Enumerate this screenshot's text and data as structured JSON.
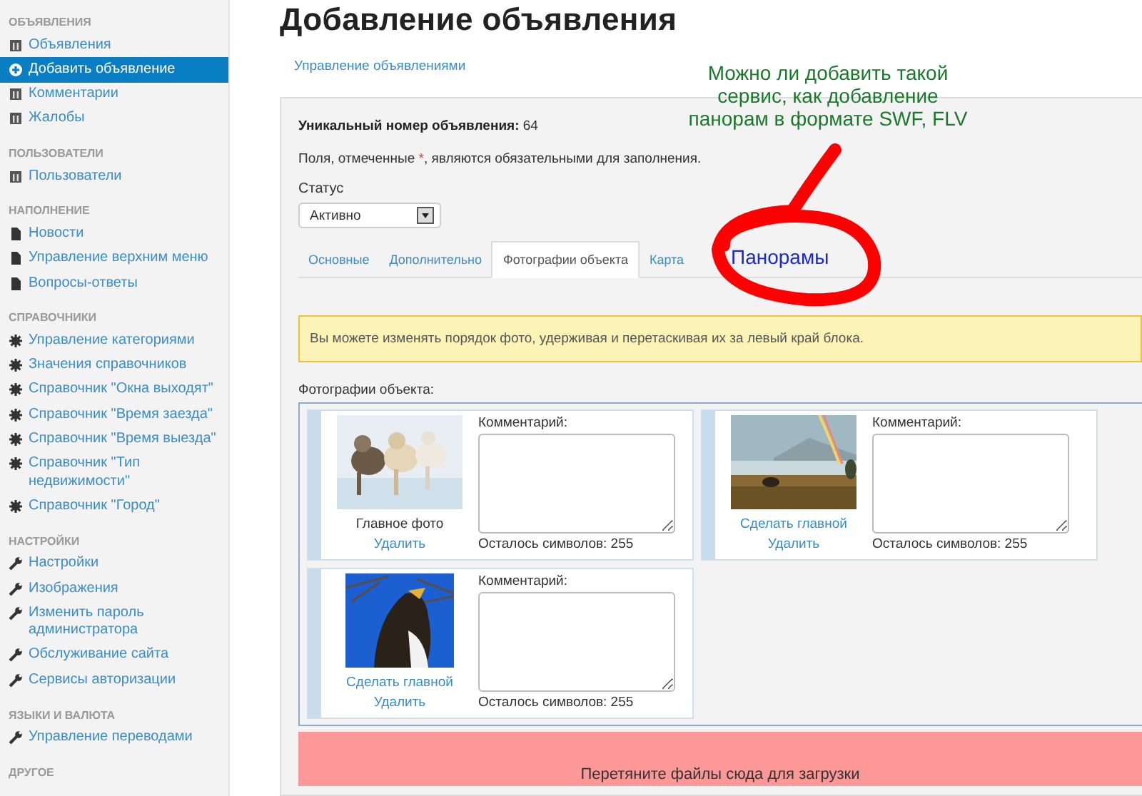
{
  "sidebar": {
    "sections": [
      {
        "title": "ОБЪЯВЛЕНИЯ",
        "items": [
          {
            "label": "Объявления",
            "kind": "table",
            "selected": false
          },
          {
            "label": "Добавить объявление",
            "kind": "plus",
            "selected": true
          },
          {
            "label": "Комментарии",
            "kind": "table",
            "selected": false
          },
          {
            "label": "Жалобы",
            "kind": "table",
            "selected": false
          }
        ]
      },
      {
        "title": "ПОЛЬЗОВАТЕЛИ",
        "items": [
          {
            "label": "Пользователи",
            "kind": "table",
            "selected": false
          }
        ]
      },
      {
        "title": "НАПОЛНЕНИЕ",
        "items": [
          {
            "label": "Новости",
            "kind": "file",
            "selected": false
          },
          {
            "label": "Управление верхним меню",
            "kind": "file",
            "selected": false
          },
          {
            "label": "Вопросы-ответы",
            "kind": "file",
            "selected": false
          }
        ]
      },
      {
        "title": "СПРАВОЧНИКИ",
        "items": [
          {
            "label": "Управление категориями",
            "kind": "gear",
            "selected": false
          },
          {
            "label": "Значения справочников",
            "kind": "gear",
            "selected": false
          },
          {
            "label": "Справочник \"Окна выходят\"",
            "kind": "gear",
            "selected": false
          },
          {
            "label": "Справочник \"Время заезда\"",
            "kind": "gear",
            "selected": false
          },
          {
            "label": "Справочник \"Время выезда\"",
            "kind": "gear",
            "selected": false
          },
          {
            "label": "Справочник \"Тип недвижимости\"",
            "kind": "gear",
            "selected": false
          },
          {
            "label": "Справочник \"Город\"",
            "kind": "gear",
            "selected": false
          }
        ]
      },
      {
        "title": "НАСТРОЙКИ",
        "items": [
          {
            "label": "Настройки",
            "kind": "wrench",
            "selected": false
          },
          {
            "label": "Изображения",
            "kind": "wrench",
            "selected": false
          },
          {
            "label": "Изменить пароль администратора",
            "kind": "wrench",
            "selected": false
          },
          {
            "label": "Обслуживание сайта",
            "kind": "wrench",
            "selected": false
          },
          {
            "label": "Сервисы авторизации",
            "kind": "wrench",
            "selected": false
          }
        ]
      },
      {
        "title": "ЯЗЫКИ И ВАЛЮТА",
        "items": [
          {
            "label": "Управление переводами",
            "kind": "wrench",
            "selected": false
          }
        ]
      },
      {
        "title": "ДРУГОЕ"
      }
    ]
  },
  "page_title": "Добавление объявления",
  "breadcrumb_link": "Управление объявлениями",
  "form": {
    "id_label": "Уникальный номер объявления:",
    "id_value": "64",
    "required_note": {
      "before": "Поля, отмеченные ",
      "mark": "*",
      "after": ", являются обязательными для заполнения."
    },
    "status": {
      "label": "Статус",
      "value": "Активно"
    },
    "tabs": [
      {
        "label": "Основные",
        "selected": false
      },
      {
        "label": "Дополнительно",
        "selected": false
      },
      {
        "label": "Фотографии объекта",
        "selected": true
      },
      {
        "label": "Карта",
        "selected": false
      }
    ],
    "hint": "Вы можете изменять порядок фото, удерживая и перетаскивая их за левый край блока.",
    "photos_label": "Фотографии объекта:",
    "photos": [
      {
        "main": true,
        "caption": "Главное фото",
        "delete": "Удалить",
        "comment_label": "Комментарий:",
        "remaining": "Осталось символов: 255"
      },
      {
        "main": false,
        "caption": "Сделать главной",
        "delete": "Удалить",
        "comment_label": "Комментарий:",
        "remaining": "Осталось символов: 255"
      },
      {
        "main": false,
        "caption": "Сделать главной",
        "delete": "Удалить",
        "comment_label": "Комментарий:",
        "remaining": "Осталось символов: 255"
      }
    ],
    "dropzone": "Перетяните файлы сюда для загрузки"
  },
  "annotation": {
    "question": "Можно ли добавить такой\nсервис, как добавление\nпанорам в формате SWF, FLV",
    "tab_label": "Панорамы"
  }
}
